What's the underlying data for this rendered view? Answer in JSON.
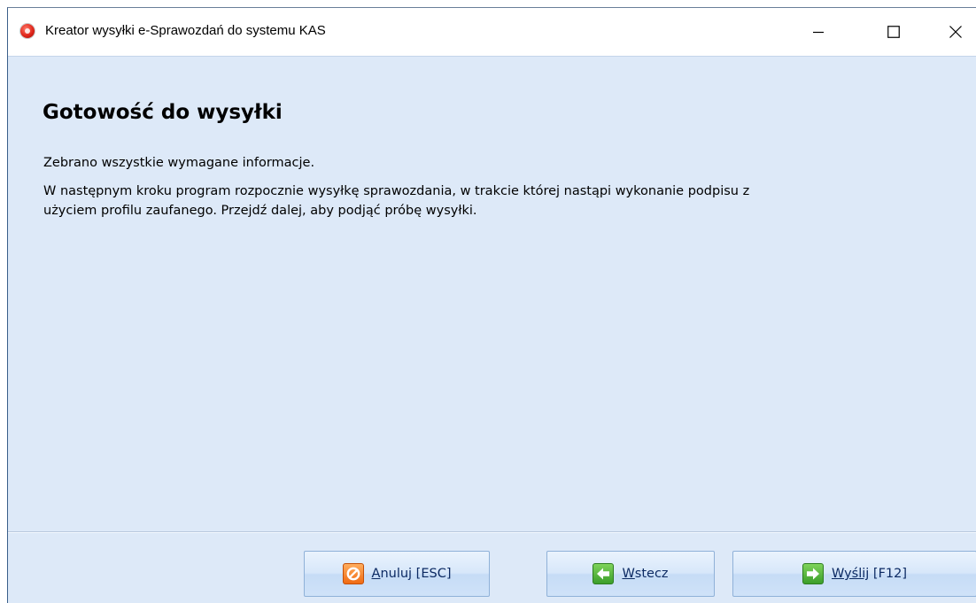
{
  "window": {
    "title": "Kreator wysyłki e-Sprawozdań do systemu KAS",
    "controls": {
      "minimize_icon": "minimize-icon",
      "maximize_icon": "maximize-icon",
      "close_icon": "close-icon"
    }
  },
  "main": {
    "heading": "Gotowość do wysyłki",
    "line1": "Zebrano wszystkie wymagane informacje.",
    "line2": "W następnym kroku program rozpocznie wysyłkę sprawozdania, w trakcie której nastąpi wykonanie podpisu z",
    "line3": "użyciem profilu zaufanego. Przejdź dalej, aby podjąć próbę wysyłki."
  },
  "buttons": {
    "cancel": {
      "accel": "A",
      "rest": "nuluj [ESC]",
      "icon": "cancel-icon"
    },
    "back": {
      "accel": "W",
      "rest": "stecz",
      "icon": "arrow-left-icon"
    },
    "send": {
      "accel": "Wyślij",
      "rest": " [F12]",
      "icon": "arrow-right-icon"
    }
  },
  "colors": {
    "client_background": "#dde9f8",
    "button_text": "#0c2a63",
    "accent_green": "#3b9e2a",
    "accent_orange": "#f06a12"
  }
}
